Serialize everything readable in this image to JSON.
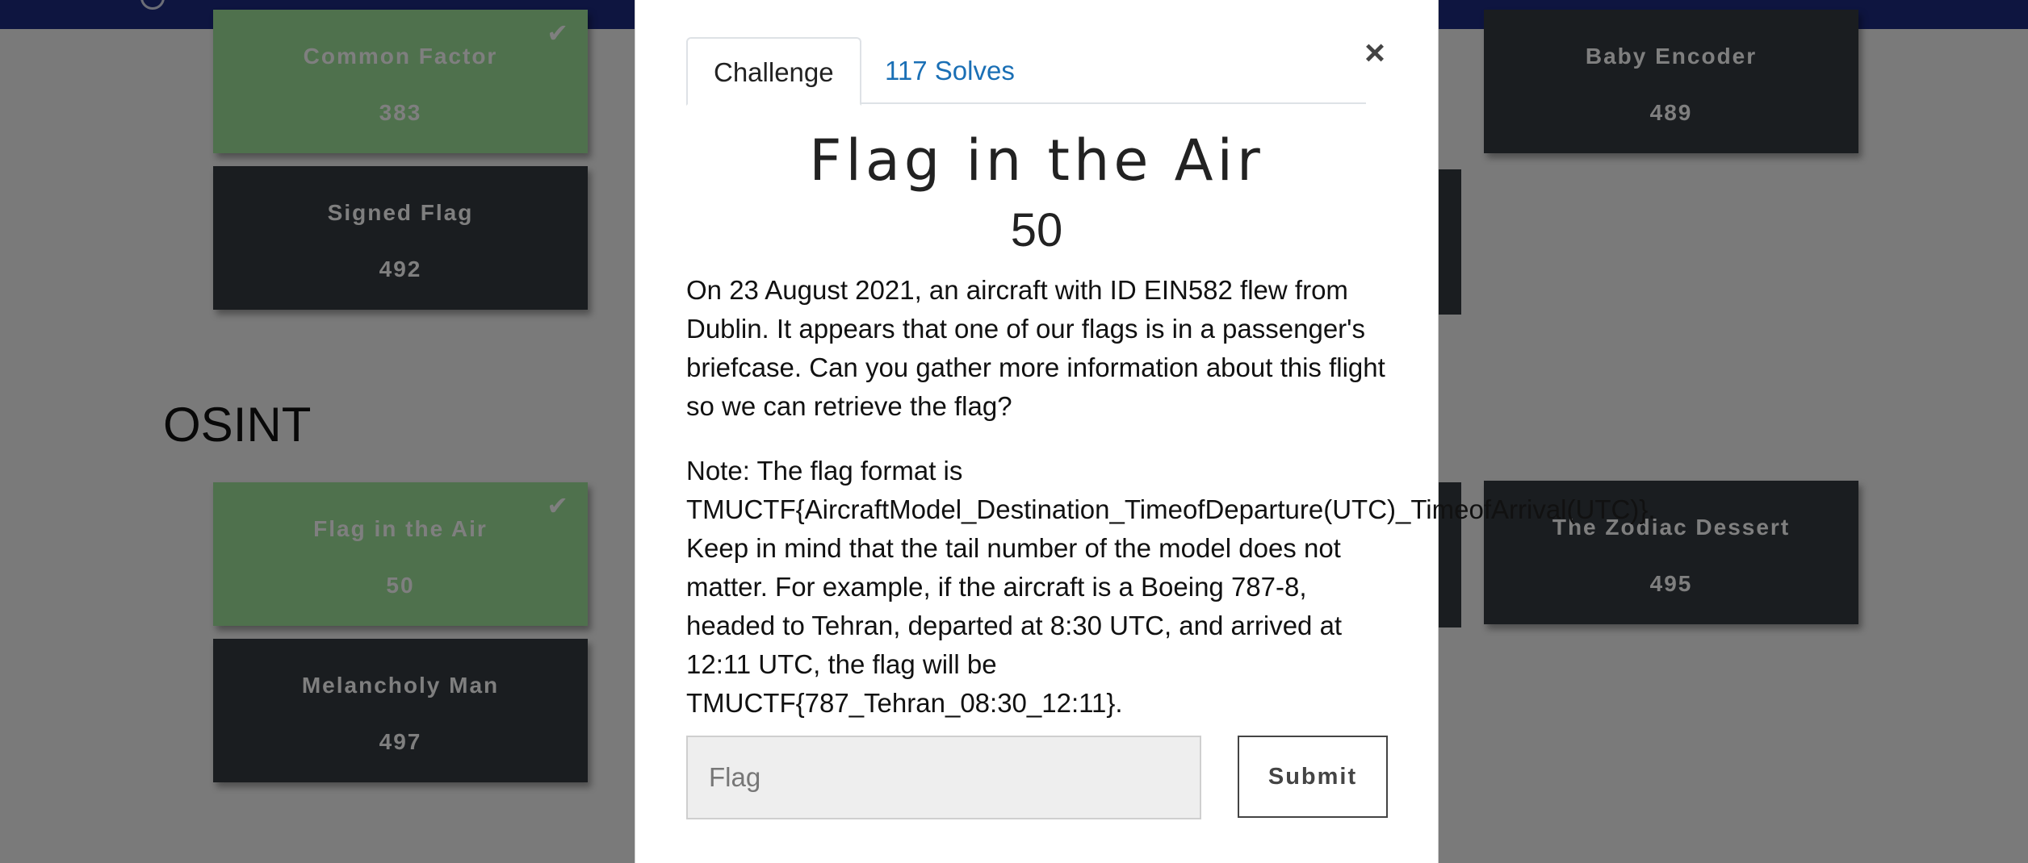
{
  "sections": [
    {
      "title": "OSINT"
    }
  ],
  "cards": {
    "common_factor": {
      "name": "Common Factor",
      "value": "383",
      "solved": true
    },
    "signed_flag": {
      "name": "Signed Flag",
      "value": "492",
      "solved": false
    },
    "baby_encoder": {
      "name": "Baby Encoder",
      "value": "489",
      "solved": false
    },
    "flag_in_the_air": {
      "name": "Flag in the Air",
      "value": "50",
      "solved": true
    },
    "melancholy_man": {
      "name": "Melancholy Man",
      "value": "497",
      "solved": false
    },
    "zodiac_dessert": {
      "name": "The Zodiac Dessert",
      "value": "495",
      "solved": false
    }
  },
  "modal": {
    "tabs": [
      {
        "label": "Challenge",
        "active": true
      },
      {
        "label": "117 Solves",
        "active": false
      }
    ],
    "close_label": "×",
    "challenge_name": "Flag in the Air",
    "challenge_value": "50",
    "description": [
      "On 23 August 2021, an aircraft with ID EIN582 flew from Dublin. It appears that one of our flags is in a passenger's briefcase. Can you gather more information about this flight so we can retrieve the flag?",
      "Note: The flag format is TMUCTF{AircraftModel_Destination_TimeofDeparture(UTC)_TimeofArrival(UTC)}. Keep in mind that the tail number of the model does not matter. For example, if the aircraft is a Boeing 787-8, headed to Tehran, departed at 8:30 UTC, and arrived at 12:11 UTC, the flag will be TMUCTF{787_Tehran_08:30_12:11}."
    ],
    "flag_input": {
      "placeholder": "Flag",
      "value": ""
    },
    "submit_label": "Submit"
  },
  "icons": {
    "solved": "check-icon",
    "close": "close-icon"
  },
  "colors": {
    "navbar": "#1c2a80",
    "card_unsolved": "#343a40",
    "card_solved": "#9ee39a",
    "link": "#1a6fb5"
  }
}
